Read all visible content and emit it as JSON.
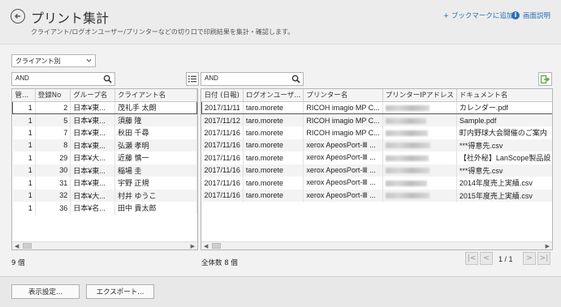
{
  "header": {
    "title": "プリント集計",
    "subtitle": "クライアント/ログオンユーザー/プリンターなどの切り口で印刷結果を集計・確認します。",
    "bookmark": "+ ブックマークに追加",
    "help": "画面説明"
  },
  "filter": {
    "selected": "クライアント別"
  },
  "left": {
    "search_value": "AND",
    "columns": [
      "管...",
      "登録No",
      "グループ名",
      "クライアント名"
    ],
    "rows": [
      {
        "kan": "1",
        "no": "2",
        "group": "日本¥東...",
        "client": "茂礼手 太朗"
      },
      {
        "kan": "1",
        "no": "5",
        "group": "日本¥東...",
        "client": "須藤 隆"
      },
      {
        "kan": "1",
        "no": "7",
        "group": "日本¥東...",
        "client": "秋田 千尋"
      },
      {
        "kan": "1",
        "no": "8",
        "group": "日本¥東...",
        "client": "弘瀬 孝明"
      },
      {
        "kan": "1",
        "no": "29",
        "group": "日本¥大...",
        "client": "近藤 慎一"
      },
      {
        "kan": "1",
        "no": "30",
        "group": "日本¥東...",
        "client": "稲場 圭"
      },
      {
        "kan": "1",
        "no": "31",
        "group": "日本¥東...",
        "client": "宇野 正規"
      },
      {
        "kan": "1",
        "no": "32",
        "group": "日本¥大...",
        "client": "村井 ゆうこ"
      },
      {
        "kan": "1",
        "no": "36",
        "group": "日本¥名...",
        "client": "田中 貴太郎"
      }
    ],
    "count": "9 個"
  },
  "right": {
    "search_value": "AND",
    "columns": [
      "日付 (日報)",
      "ログオンユーザ...",
      "プリンター名",
      "プリンターIPアドレス",
      "ドキュメント名"
    ],
    "rows": [
      {
        "date": "2017/11/11",
        "user": "taro.morete",
        "printer": "RICOH imagio MP C...",
        "doc": "カレンダー.pdf"
      },
      {
        "date": "2017/11/12",
        "user": "taro.morete",
        "printer": "RICOH imagio MP C...",
        "doc": "Sample.pdf"
      },
      {
        "date": "2017/11/16",
        "user": "taro.morete",
        "printer": "RICOH imagio MP C...",
        "doc": "町内野球大会開催のご案内"
      },
      {
        "date": "2017/11/16",
        "user": "taro.morete",
        "printer": "xerox ApeosPort-Ⅲ ...",
        "doc": "***得意先.csv"
      },
      {
        "date": "2017/11/16",
        "user": "taro.morete",
        "printer": "xerox ApeosPort-Ⅲ ...",
        "doc": "【社外秘】LanScope製品設"
      },
      {
        "date": "2017/11/16",
        "user": "taro.morete",
        "printer": "xerox ApeosPort-Ⅲ ...",
        "doc": "***得意先.csv"
      },
      {
        "date": "2017/11/16",
        "user": "taro.morete",
        "printer": "xerox ApeosPort-Ⅲ ...",
        "doc": "2014年度売上実績.csv"
      },
      {
        "date": "2017/11/16",
        "user": "taro.morete",
        "printer": "xerox ApeosPort-Ⅲ ...",
        "doc": "2015年度売上実績.csv"
      }
    ],
    "count": "全体数 8 個",
    "page": "1 / 1"
  },
  "footer": {
    "display_settings": "表示設定...",
    "export": "エクスポート..."
  }
}
